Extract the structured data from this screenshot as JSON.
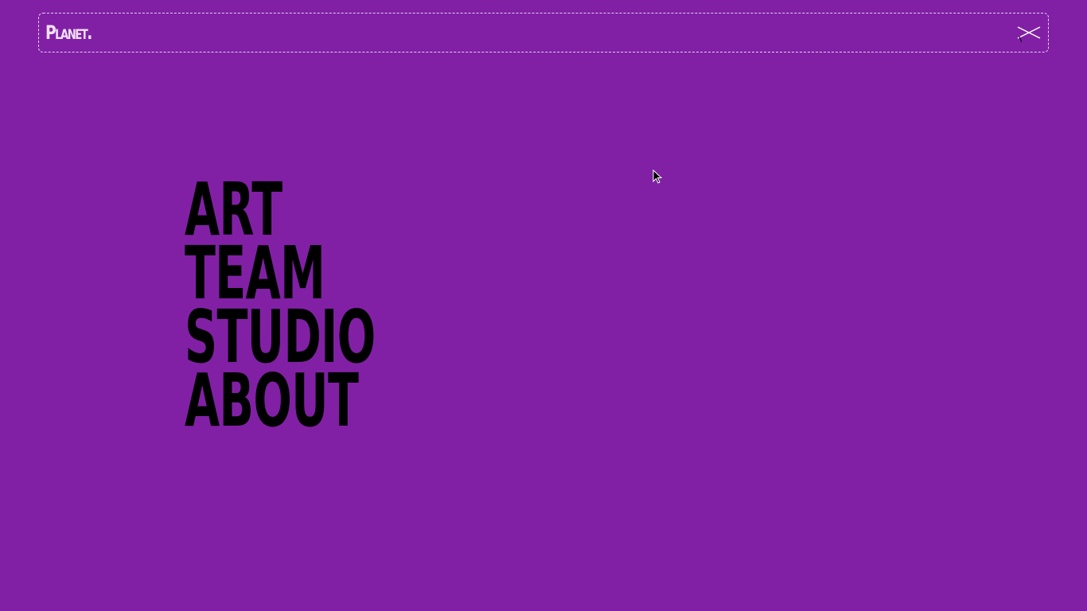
{
  "header": {
    "logo_text": "Planet.",
    "close_icon": "close-icon"
  },
  "menu": {
    "items": [
      {
        "label": "ART"
      },
      {
        "label": "TEAM"
      },
      {
        "label": "STUDIO"
      },
      {
        "label": "ABOUT"
      }
    ]
  },
  "colors": {
    "background": "#8120a5",
    "border": "#e8cdf2",
    "logo": "#f2e0f7",
    "menu_text": "#000000"
  }
}
